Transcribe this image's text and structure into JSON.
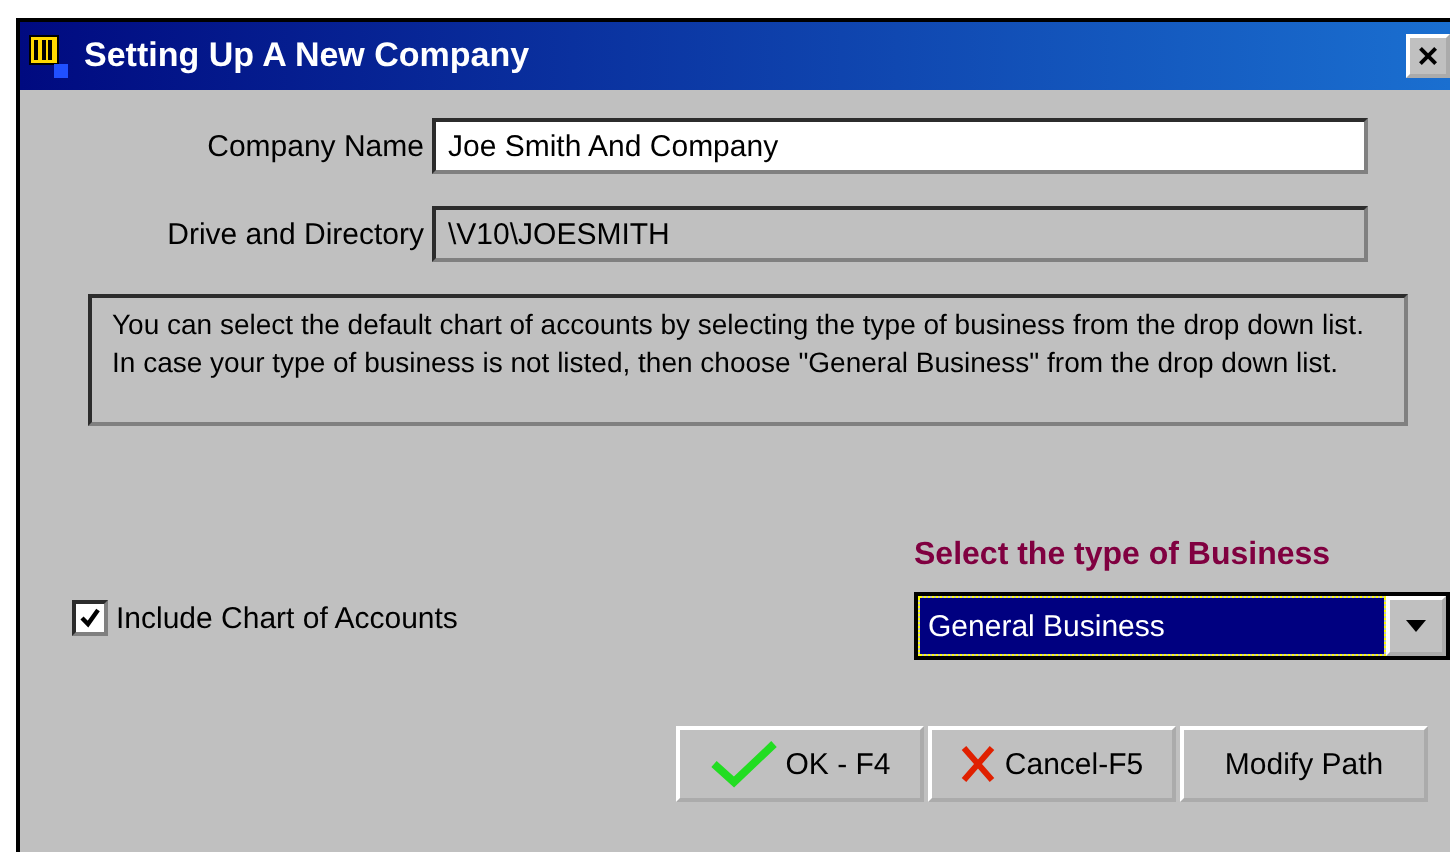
{
  "window": {
    "title": "Setting Up A New Company",
    "close": "×"
  },
  "fields": [
    {
      "label": "Company Name",
      "value": "Joe Smith And Company",
      "disabled": false
    },
    {
      "label": "Drive and Directory",
      "value": "\\V10\\JOESMITH",
      "disabled": true
    }
  ],
  "info": "You can select the default chart of accounts by selecting the type of business from the drop down list.  In case your type of business is not listed, then choose \"General Business\" from the drop down list.",
  "include_chart": {
    "label": "Include Chart of Accounts",
    "checked": true
  },
  "business_type": {
    "label": "Select the type of Business",
    "value": "General Business"
  },
  "buttons": [
    {
      "kind": "ok",
      "label": "OK - F4"
    },
    {
      "kind": "cancel",
      "label": "Cancel-F5"
    },
    {
      "kind": "plain",
      "label": "Modify Path"
    }
  ]
}
